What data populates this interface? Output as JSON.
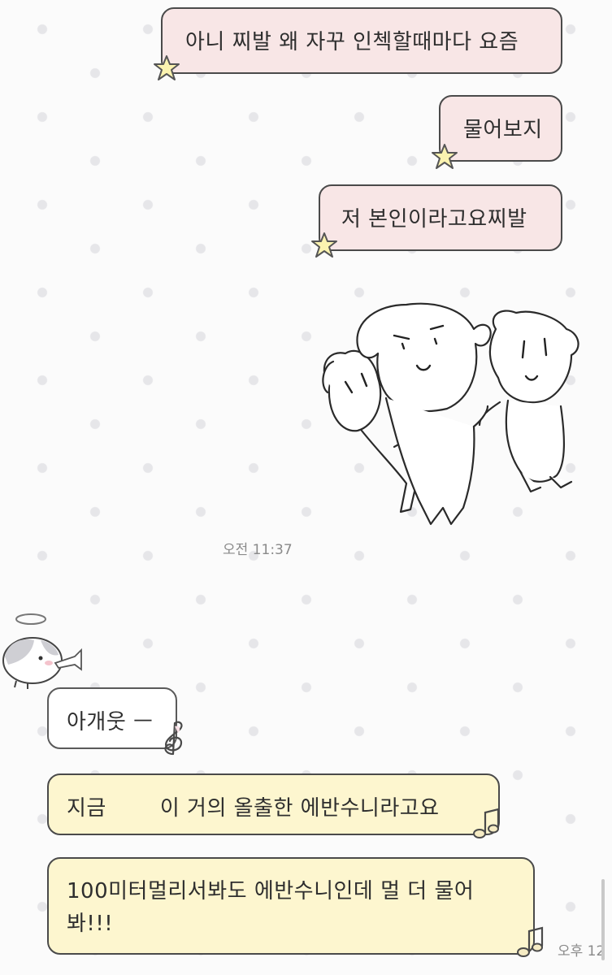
{
  "messages": {
    "sent_1": "아니 찌발 왜 자꾸 인첵할때마다 요즘",
    "sent_2": "물어보지",
    "sent_3": "저 본인이라고요찌발",
    "sent_time": "오전 11:37",
    "recv_1": "아개웃 ㅡ",
    "recv_2_before": "지금",
    "recv_2_after": "이 거의 올출한 에반수니라고요",
    "recv_3_line1": "100미터멀리서봐도 에반수니인데 멀 더 물어",
    "recv_3_line2": "봐!!!",
    "recv_time": "오후 12"
  },
  "colors": {
    "sent_bubble": "#f8e6e6",
    "white_bubble": "#ffffff",
    "yellow_bubble": "#fdf6cf",
    "bubble_border": "#4a4a4a"
  },
  "icons": {
    "sent_decoration": "star-icon",
    "recv_decoration_1": "treble-clef-icon",
    "recv_decoration_2": "music-note-icon"
  }
}
